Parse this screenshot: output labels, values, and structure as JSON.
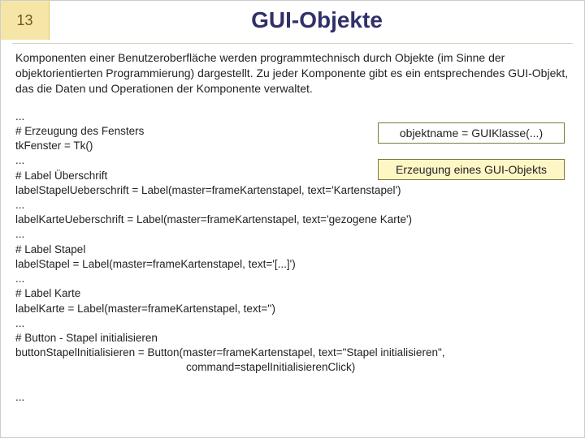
{
  "slide_number": "13",
  "title": "GUI-Objekte",
  "intro": "Komponenten einer Benutzeroberfläche werden programmtechnisch durch Objekte (im Sinne der objektorientierten Programmierung) dargestellt. Zu jeder Komponente gibt es ein entsprechendes GUI-Objekt, das die Daten und Operationen der Komponente verwaltet.",
  "callout_top": "objektname = GUIKlasse(...)",
  "callout_bottom": "Erzeugung eines GUI-Objekts",
  "code": {
    "l01": "...",
    "l02": "# Erzeugung des Fensters",
    "l03": "tkFenster = Tk()",
    "l04": "...",
    "l05": "# Label Überschrift",
    "l06": "labelStapelUeberschrift = Label(master=frameKartenstapel, text='Kartenstapel')",
    "l07": "...",
    "l08": "labelKarteUeberschrift = Label(master=frameKartenstapel, text='gezogene Karte')",
    "l09": "...",
    "l10": "# Label Stapel",
    "l11": "labelStapel = Label(master=frameKartenstapel, text='[...]')",
    "l12": "...",
    "l13": "# Label Karte",
    "l14": "labelKarte = Label(master=frameKartenstapel, text='')",
    "l15": "...",
    "l16": "# Button - Stapel initialisieren",
    "l17": "buttonStapelInitialisieren = Button(master=frameKartenstapel, text=\"Stapel initialisieren\",",
    "l18": "command=stapelInitialisierenClick)",
    "l19": "..."
  }
}
